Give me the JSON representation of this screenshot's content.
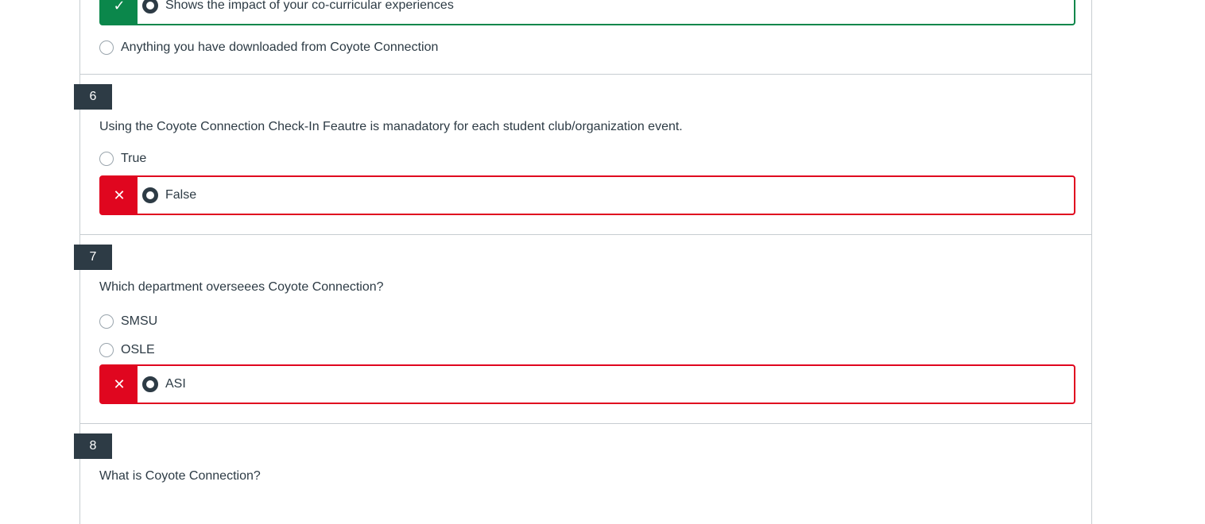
{
  "colors": {
    "correct": "#0b874b",
    "incorrect": "#e0061f",
    "badge": "#2d3b45",
    "text": "#2d3b45"
  },
  "icons": {
    "correct": "checkmark-icon",
    "incorrect": "x-icon"
  },
  "q5": {
    "selected_answer": "Shows the impact of your co-curricular experiences",
    "other_option": "Anything you have downloaded from Coyote Connection"
  },
  "q6": {
    "number": "6",
    "text": "Using the Coyote Connection Check-In Feautre is manadatory for each student club/organization event.",
    "option_1": "True",
    "selected_answer": "False"
  },
  "q7": {
    "number": "7",
    "text": "Which department overseees Coyote Connection?",
    "option_1": "SMSU",
    "option_2": "OSLE",
    "selected_answer": "ASI"
  },
  "q8": {
    "number": "8",
    "text": "What is Coyote Connection?"
  }
}
